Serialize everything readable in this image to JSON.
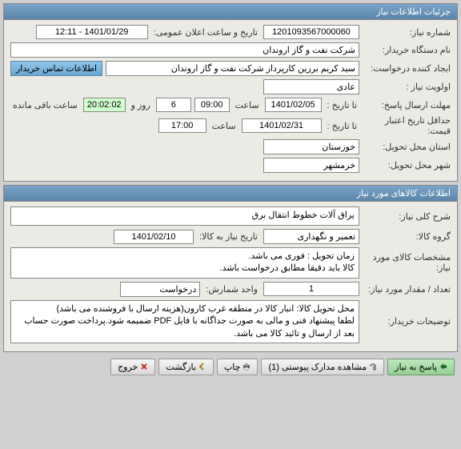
{
  "panels": {
    "need_info_title": "جزئیات اطلاعات نیاز",
    "goods_info_title": "اطلاعات کالاهای مورد نیاز"
  },
  "need": {
    "number_label": "شماره نیاز:",
    "number": "1201093567000060",
    "public_dt_label": "تاریخ و ساعت اعلان عمومی:",
    "public_dt": "1401/01/29 - 12:11",
    "buyer_label": "نام دستگاه خریدار:",
    "buyer": "شرکت نفت و گاز اروندان",
    "requester_label": "ایجاد کننده درخواست:",
    "requester": "سید کریم برزین کارپرداز شرکت نفت و گاز اروندان",
    "contact_btn": "اطلاعات تماس خریدار",
    "priority_label": "اولویت نیاز :",
    "priority": "عادی",
    "deadline_label": "مهلت ارسال پاسخ:",
    "to_date_label": "تا تاریخ :",
    "deadline_date": "1401/02/05",
    "time_label": "ساعت",
    "deadline_time": "09:00",
    "remain_days": "6",
    "remain_days_unit": "روز و",
    "remain_time": "20:02:02",
    "remain_suffix": "ساعت باقی مانده",
    "price_valid_label": "حداقل تاریخ اعتبار قیمت:",
    "price_valid_date": "1401/02/31",
    "price_valid_time": "17:00",
    "province_label": "استان محل تحویل:",
    "province": "خوزستان",
    "city_label": "شهر محل تحویل:",
    "city": "خرمشهر"
  },
  "goods": {
    "desc_label": "شرح کلی نیاز:",
    "desc": "یراق آلات خطوط انتقال برق",
    "group_label": "گروه کالا:",
    "group": "تعمیر و نگهداری",
    "need_date_label": "تاریخ نیاز به کالا:",
    "need_date": "1401/02/10",
    "spec_label": "مشخصات کالای مورد نیاز:",
    "spec": "زمان تحویل : فوری می باشد.\nکالا باید دقیقا مطابق درخواست باشد.",
    "qty_label": "تعداد / مقدار مورد نیاز:",
    "qty": "1",
    "unit_label": "واحد شمارش:",
    "unit": "درخواست",
    "buyer_notes_label": "توضیحات خریدار:",
    "buyer_notes": "محل تحویل کالا: انبار کالا در منطقه  غرب کارون(هزینه ارسال با فروشنده می باشد)\nلطفا پیشنهاد فنی و مالی به صورت جداگانه با فایل PDF  ضمیمه شود.پرداخت صورت حساب بعد از ارسال و تائید کالا می باشد."
  },
  "footer": {
    "reply": "پاسخ به نیاز",
    "attachments": "مشاهده مدارک پیوستی (1)",
    "print": "چاپ",
    "back": "بازگشت",
    "exit": "خروج"
  }
}
